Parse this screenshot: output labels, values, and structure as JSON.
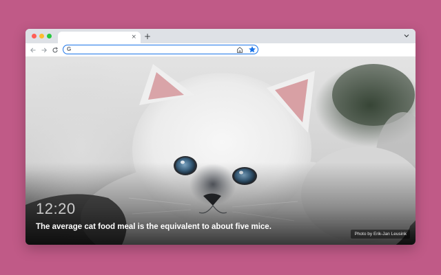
{
  "browser": {
    "tab": {
      "close_glyph": "×"
    },
    "new_tab_glyph": "+",
    "tab_menu_icon": "chevron-down-icon",
    "nav_icons": [
      "arrow-left-icon",
      "arrow-right-icon",
      "reload-icon"
    ],
    "omnibox": {
      "value": "",
      "provider_glyph": "G"
    },
    "toolbar_icons": [
      "home-icon",
      "star-icon"
    ],
    "accent_color": "#1a73e8"
  },
  "new_tab_page": {
    "time": "12:20",
    "fact": "The average cat food meal is the equivalent to about five mice.",
    "photo_credit": "Photo by Erik-Jan Leusink"
  },
  "colors": {
    "page_background": "#c05a87",
    "traffic_red": "#ff5f57",
    "traffic_yellow": "#febc2e",
    "traffic_green": "#28c840"
  }
}
